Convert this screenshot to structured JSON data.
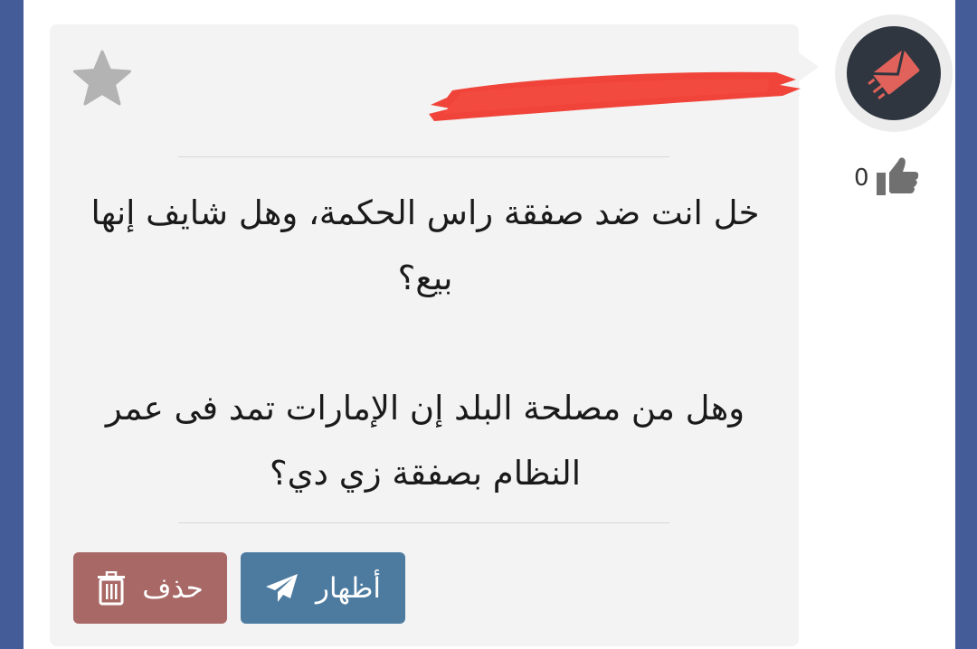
{
  "post": {
    "message_lines": [
      "خل انت ضد صفقة راس الحكمة، وهل شايف إنها بيع؟",
      "وهل من مصلحة البلد إن الإمارات تمد فى عمر النظام بصفقة زي دي؟"
    ],
    "like_count": "0"
  },
  "actions": {
    "show_label": "أظهار",
    "delete_label": "حذف"
  },
  "icons": {
    "favorite": "star-icon",
    "show": "paper-plane-icon",
    "delete": "trash-icon",
    "like": "thumbs-up-icon",
    "avatar": "envelope-send-icon"
  },
  "colors": {
    "page_bg": "#445c97",
    "card_bg": "#f3f3f3",
    "show_button": "#4d7ba0",
    "delete_button": "#a86866",
    "redaction": "#f0443a",
    "avatar_bg": "#2f3640",
    "avatar_icon": "#e0625a"
  }
}
